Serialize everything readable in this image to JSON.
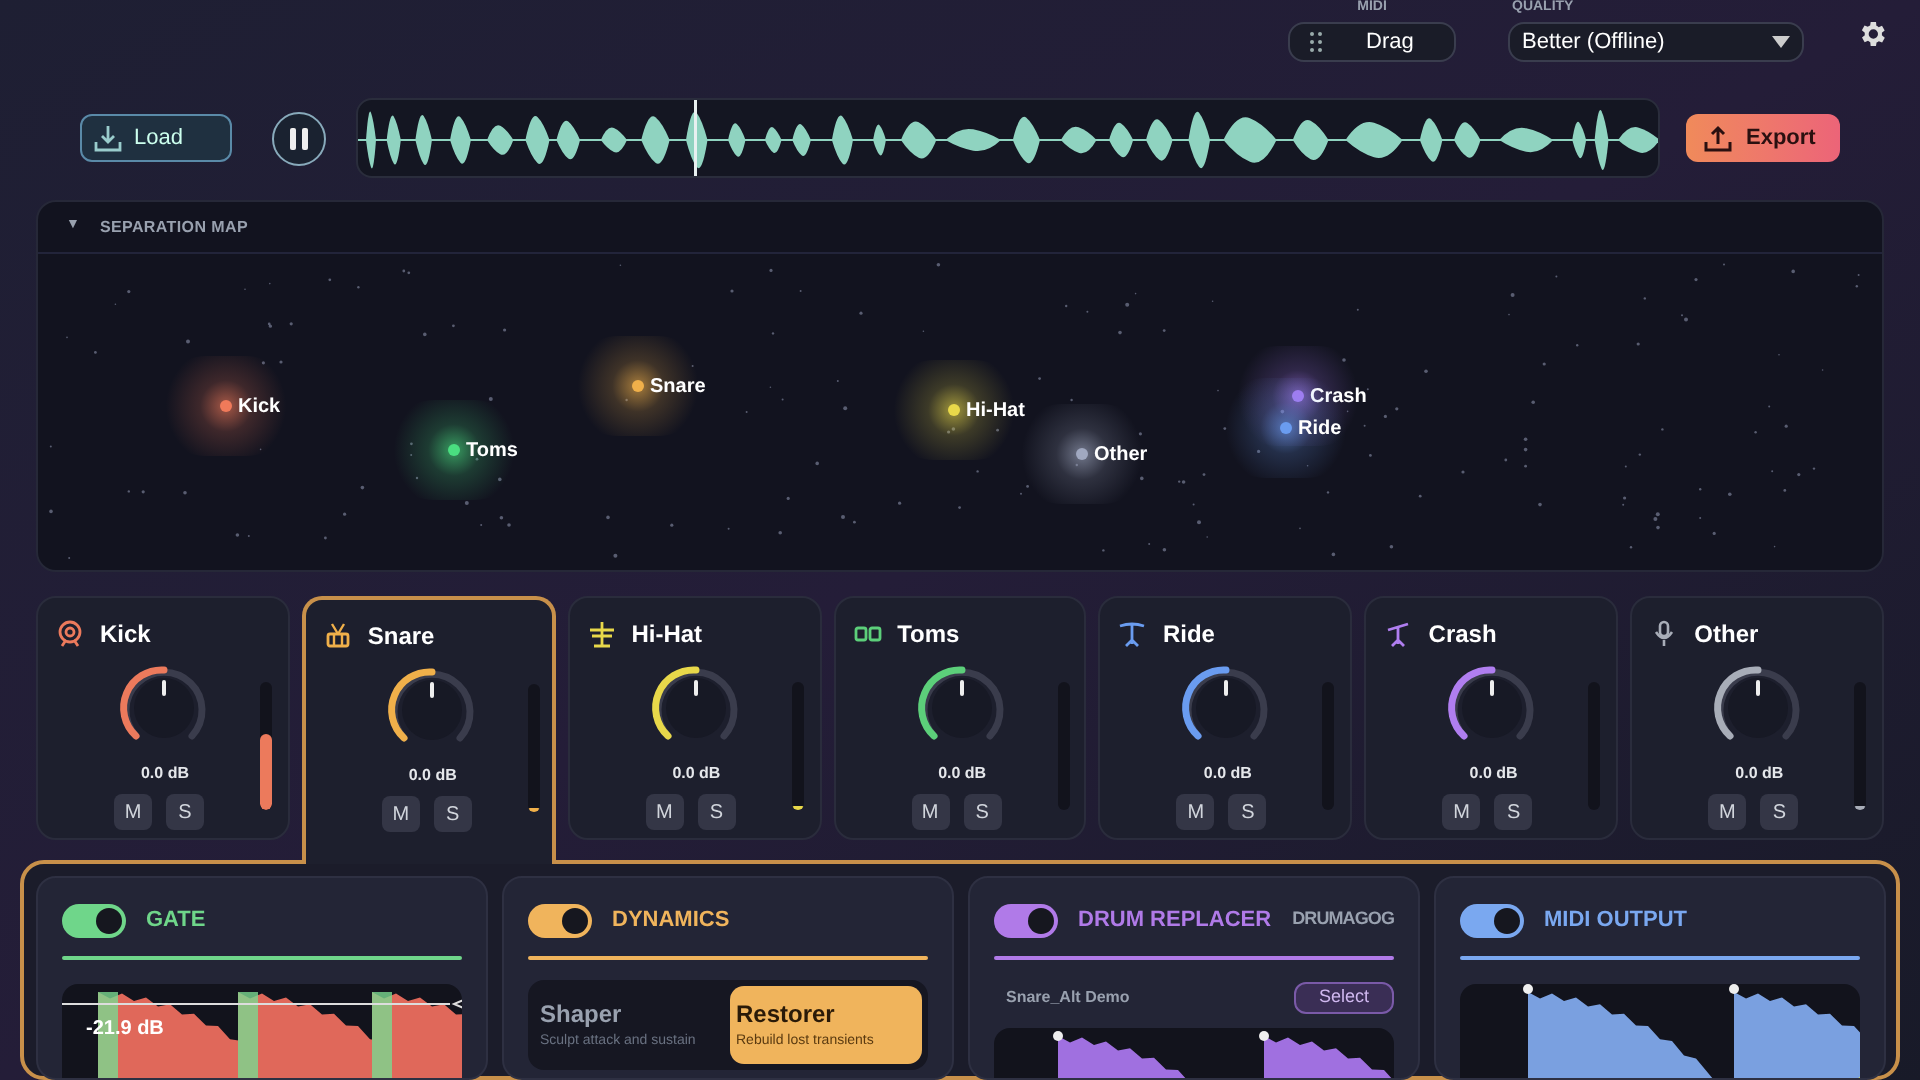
{
  "header": {
    "midi": {
      "label": "MIDI",
      "button": "Drag"
    },
    "quality": {
      "label": "QUALITY",
      "value": "Better (Offline)"
    }
  },
  "transport": {
    "load": "Load",
    "playing": true,
    "export": "Export"
  },
  "separation_map": {
    "toggle": "▼",
    "title": "SEPARATION MAP",
    "clusters": [
      {
        "label": "Kick",
        "color": "#f07a5a"
      },
      {
        "label": "Toms",
        "color": "#4ade80"
      },
      {
        "label": "Snare",
        "color": "#f0b04a"
      },
      {
        "label": "Hi-Hat",
        "color": "#e8d84a"
      },
      {
        "label": "Other",
        "color": "#a0a8c0"
      },
      {
        "label": "Crash",
        "color": "#a678f0"
      },
      {
        "label": "Ride",
        "color": "#6a9cf0"
      }
    ]
  },
  "stems": [
    {
      "name": "Kick",
      "color": "#ec7a5c",
      "gain": "0.0 dB",
      "level": 0.6,
      "selected": false,
      "m": "M",
      "s": "S"
    },
    {
      "name": "Snare",
      "color": "#f0b04a",
      "gain": "0.0 dB",
      "level": 0.02,
      "selected": true,
      "m": "M",
      "s": "S"
    },
    {
      "name": "Hi-Hat",
      "color": "#e8d84a",
      "gain": "0.0 dB",
      "level": 0.02,
      "selected": false,
      "m": "M",
      "s": "S"
    },
    {
      "name": "Toms",
      "color": "#5ccf7a",
      "gain": "0.0 dB",
      "level": 0,
      "selected": false,
      "m": "M",
      "s": "S"
    },
    {
      "name": "Ride",
      "color": "#6a9cf0",
      "gain": "0.0 dB",
      "level": 0,
      "selected": false,
      "m": "M",
      "s": "S"
    },
    {
      "name": "Crash",
      "color": "#b07ef0",
      "gain": "0.0 dB",
      "level": 0,
      "selected": false,
      "m": "M",
      "s": "S"
    },
    {
      "name": "Other",
      "color": "#a8adb8",
      "gain": "0.0 dB",
      "level": 0.02,
      "selected": false,
      "m": "M",
      "s": "S"
    }
  ],
  "modules": [
    {
      "kind": "gate",
      "title": "GATE",
      "on": true,
      "color": "#6fd68a",
      "reading": "-21.9 dB"
    },
    {
      "kind": "dynamics",
      "title": "DYNAMICS",
      "on": true,
      "color": "#f0b45c",
      "modes": [
        {
          "title": "Shaper",
          "subtitle": "Sculpt attack and sustain",
          "selected": false
        },
        {
          "title": "Restorer",
          "subtitle": "Rebuild lost transients",
          "selected": true
        }
      ]
    },
    {
      "kind": "drum_replacer",
      "title": "DRUM REPLACER",
      "on": true,
      "color": "#b07ae8",
      "brand": "DRUMAGOG",
      "sample": "Snare_Alt Demo",
      "button": "Select"
    },
    {
      "kind": "midi_output",
      "title": "MIDI OUTPUT",
      "on": true,
      "color": "#7aa8f0"
    }
  ]
}
